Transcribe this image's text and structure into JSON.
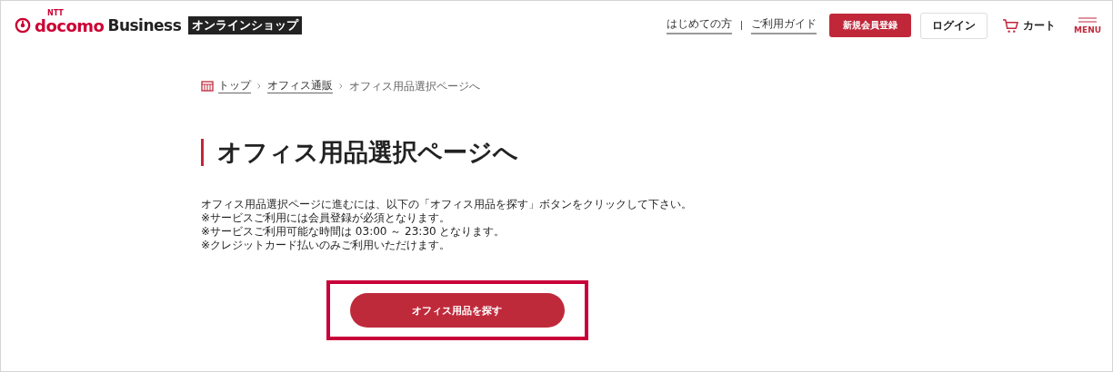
{
  "header": {
    "logo": {
      "brand_small": "NTT",
      "brand": "docomo",
      "brand_suffix": "Business",
      "badge": "オンラインショップ"
    },
    "links": [
      "はじめての方",
      "ご利用ガイド"
    ],
    "register_button": "新規会員登録",
    "login_button": "ログイン",
    "cart": "カート",
    "menu": "MENU"
  },
  "breadcrumb": [
    {
      "label": "トップ",
      "kind": "home"
    },
    {
      "label": "オフィス通販",
      "kind": "link"
    },
    {
      "label": "オフィス用品選択ページへ",
      "kind": "current"
    }
  ],
  "title": "オフィス用品選択ページへ",
  "description": "オフィス用品選択ページに進むには、以下の「オフィス用品を探す」ボタンをクリックして下さい。",
  "notes": [
    "※サービスご利用には会員登録が必須となります。",
    "※サービスご利用可能な時間は 03:00 ～ 23:30 となります。",
    "※クレジットカード払いのみご利用いただけます。"
  ],
  "action": {
    "label": "オフィス用品を探す",
    "highlighted": true
  }
}
